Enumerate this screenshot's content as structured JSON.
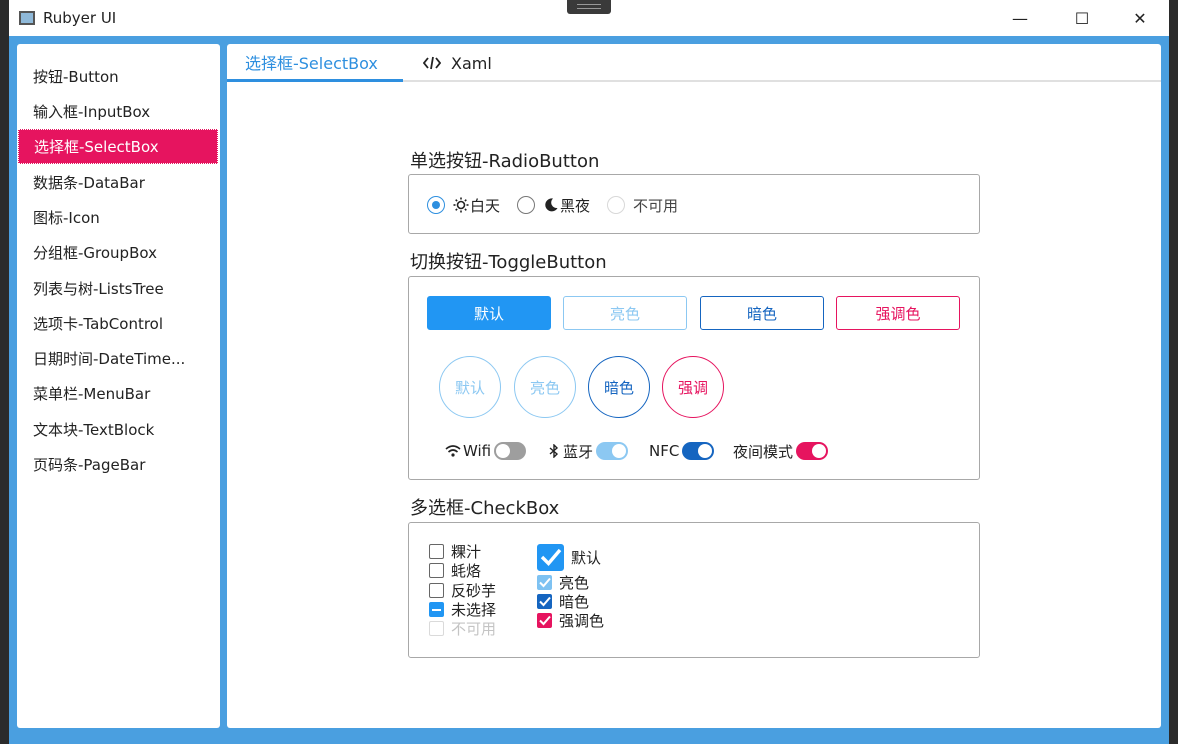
{
  "window": {
    "title": "Rubyer UI",
    "minimize_glyph": "—",
    "maximize_glyph": "☐",
    "close_glyph": "✕"
  },
  "sidebar": {
    "items": [
      {
        "label": "按钮-Button"
      },
      {
        "label": "输入框-InputBox"
      },
      {
        "label": "选择框-SelectBox",
        "active": true
      },
      {
        "label": "数据条-DataBar"
      },
      {
        "label": "图标-Icon"
      },
      {
        "label": "分组框-GroupBox"
      },
      {
        "label": "列表与树-ListsTree"
      },
      {
        "label": "选项卡-TabControl"
      },
      {
        "label": "日期时间-DateTime..."
      },
      {
        "label": "菜单栏-MenuBar"
      },
      {
        "label": "文本块-TextBlock"
      },
      {
        "label": "页码条-PageBar"
      }
    ]
  },
  "tabs": {
    "selectbox": "选择框-SelectBox",
    "xaml": "Xaml",
    "xaml_icon": "code-icon"
  },
  "radio": {
    "title": "单选按钮-RadioButton",
    "day": "白天",
    "night": "黑夜",
    "disabled": "不可用",
    "day_icon": "sun-icon",
    "night_icon": "moon-icon"
  },
  "toggle": {
    "title": "切换按钮-ToggleButton",
    "rect_buttons": [
      "默认",
      "亮色",
      "暗色",
      "强调色"
    ],
    "circle_buttons": [
      "默认",
      "亮色",
      "暗色",
      "强调"
    ],
    "switches": {
      "wifi": "Wifi",
      "bluetooth": "蓝牙",
      "nfc": "NFC",
      "night_mode": "夜间模式"
    }
  },
  "checkbox": {
    "title": "多选框-CheckBox",
    "left": [
      "粿汁",
      "蚝烙",
      "反砂芋",
      "未选择",
      "不可用"
    ],
    "right": [
      "默认",
      "亮色",
      "暗色",
      "强调色"
    ]
  },
  "colors": {
    "default": "#2196f3",
    "light": "#64b5f6",
    "dark": "#1565c0",
    "accent": "#e6145f"
  }
}
